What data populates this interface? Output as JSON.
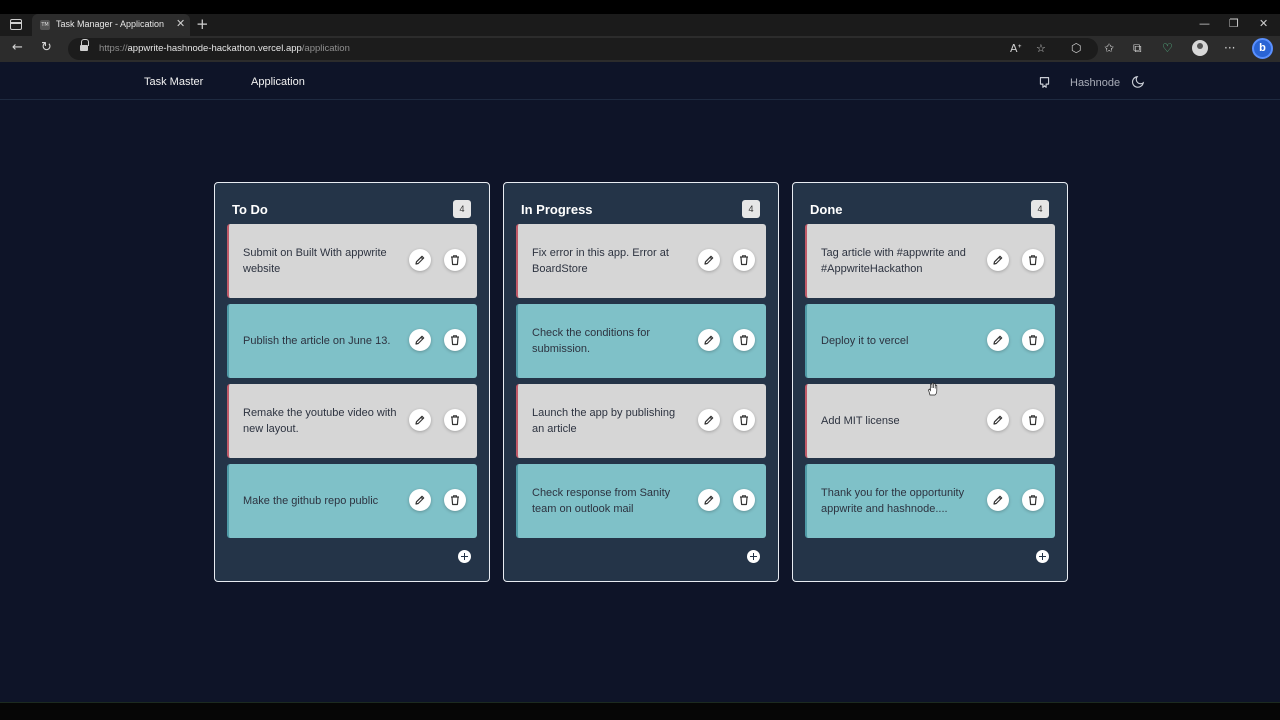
{
  "browser": {
    "tab_title": "Task Manager - Application",
    "favicon_text": "TM",
    "url_scheme": "https://",
    "url_host": "appwrite-hashnode-hackathon.vercel.app",
    "url_path": "/application"
  },
  "nav": {
    "brand": "Task Master",
    "application_link": "Application",
    "hashnode_link": "Hashnode"
  },
  "board": {
    "columns": [
      {
        "title": "To Do",
        "count": "4",
        "cards": [
          {
            "text": "Submit on Built With appwrite website",
            "style": "light"
          },
          {
            "text": "Publish the article on June 13.",
            "style": "teal"
          },
          {
            "text": "Remake the youtube video with new layout.",
            "style": "light"
          },
          {
            "text": "Make the github repo public",
            "style": "teal"
          }
        ]
      },
      {
        "title": "In Progress",
        "count": "4",
        "cards": [
          {
            "text": "Fix error in this app. Error at BoardStore",
            "style": "light"
          },
          {
            "text": "Check the conditions for submission.",
            "style": "teal"
          },
          {
            "text": "Launch the app by publishing an article",
            "style": "light"
          },
          {
            "text": "Check response from Sanity team on outlook mail",
            "style": "teal"
          }
        ]
      },
      {
        "title": "Done",
        "count": "4",
        "cards": [
          {
            "text": "Tag article with #appwrite and #AppwriteHackathon",
            "style": "light"
          },
          {
            "text": "Deploy it to vercel",
            "style": "teal"
          },
          {
            "text": "Add MIT license",
            "style": "light"
          },
          {
            "text": "Thank you for the opportunity appwrite and hashnode....",
            "style": "teal"
          }
        ]
      }
    ]
  },
  "colors": {
    "app_background": "#0e1428",
    "column_background": "#243448",
    "card_light": "#d6d6d6",
    "card_teal": "#7fc1c8"
  }
}
